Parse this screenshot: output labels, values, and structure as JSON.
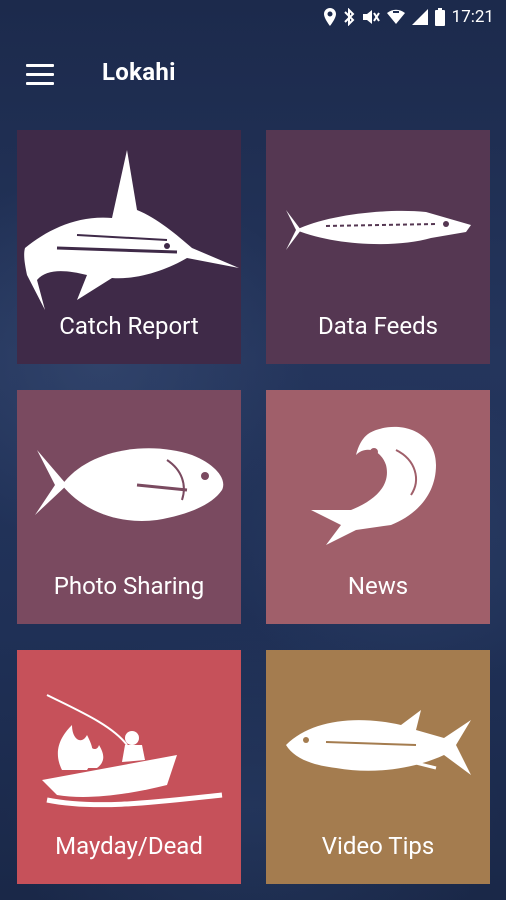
{
  "status_bar": {
    "time": "17:21",
    "icons": [
      "location-icon",
      "bluetooth-icon",
      "mute-icon",
      "wifi-icon",
      "signal-icon",
      "battery-icon"
    ]
  },
  "app_bar": {
    "menu_icon": "hamburger-menu-icon",
    "title": "Lokahi"
  },
  "tiles": [
    {
      "label": "Catch Report",
      "icon": "marlin-icon",
      "color": "#3f2a48"
    },
    {
      "label": "Data Feeds",
      "icon": "wahoo-icon",
      "color": "#553752"
    },
    {
      "label": "Photo Sharing",
      "icon": "trevally-icon",
      "color": "#7a4a60"
    },
    {
      "label": "News",
      "icon": "mahimahi-icon",
      "color": "#a05f6a"
    },
    {
      "label": "Mayday/Dead",
      "icon": "burning-boat-icon",
      "color": "#c6515a"
    },
    {
      "label": "Video Tips",
      "icon": "tuna-icon",
      "color": "#a47c4f"
    }
  ]
}
